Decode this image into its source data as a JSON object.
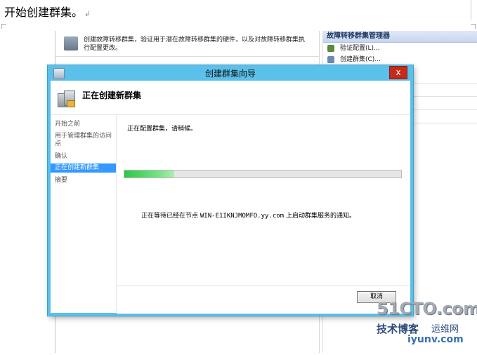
{
  "document": {
    "heading": "开始创建群集。",
    "paragraph_mark": "↲"
  },
  "background_window": {
    "description": "创建故障转移群集，验证用于潜在故障转移群集的硬件，以及对故障转移群集执行配置更改。",
    "actions_title": "故障转移群集管理器",
    "actions": [
      {
        "label": "验证配置(L)..."
      },
      {
        "label": "创建群集(C)..."
      }
    ]
  },
  "wizard": {
    "title": "创建群集向导",
    "close_glyph": "x",
    "header_title": "正在创建新群集",
    "nav": [
      {
        "label": "开始之前",
        "selected": false
      },
      {
        "label": "用于管理群集的访问点",
        "selected": false
      },
      {
        "label": "确认",
        "selected": false
      },
      {
        "label": "正在创建新群集",
        "selected": true
      },
      {
        "label": "摘要",
        "selected": false
      }
    ],
    "status_text": "正在配置群集，请稍候。",
    "progress_fraction": 0.18,
    "waiting_prefix": "正在等待已经在节点",
    "node_name": "WIN-E1IKNJMOMFO.yy.com",
    "waiting_suffix": "上启动群集服务的通知。",
    "cancel_label": "取消"
  },
  "watermark": {
    "main": "51CTO.com",
    "sub1": "技术博客",
    "sub2": "运维网",
    "sub3": "iyunv.com"
  },
  "colors": {
    "title_bar": "#5bc0ea",
    "nav_selected": "#3399ff",
    "progress_fill": "#2cc646",
    "close_button": "#c42b1c"
  }
}
